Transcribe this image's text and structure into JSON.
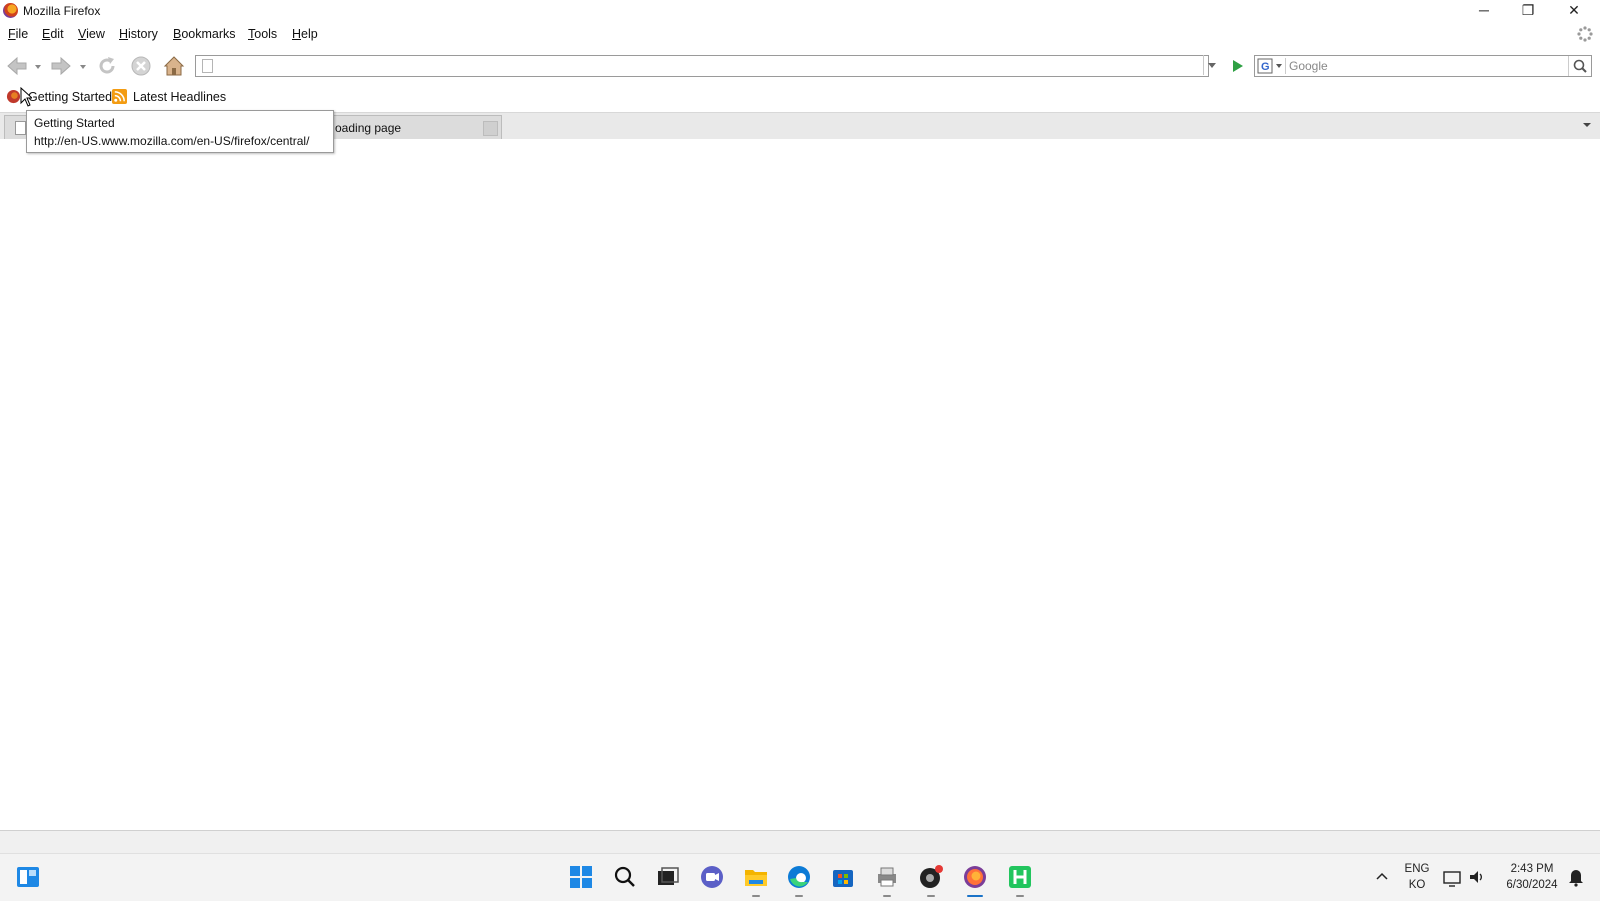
{
  "window": {
    "title": "Mozilla Firefox",
    "controls": {
      "minimize": "─",
      "maximize": "❐",
      "close": "✕"
    }
  },
  "menu": {
    "items": [
      {
        "label": "File",
        "underline": "F",
        "rest": "ile"
      },
      {
        "label": "Edit",
        "underline": "E",
        "rest": "dit"
      },
      {
        "label": "View",
        "underline": "V",
        "rest": "iew"
      },
      {
        "label": "History",
        "underline": "H",
        "rest": "istory"
      },
      {
        "label": "Bookmarks",
        "underline": "B",
        "rest": "ookmarks"
      },
      {
        "label": "Tools",
        "underline": "T",
        "rest": "ools"
      },
      {
        "label": "Help",
        "underline": "H",
        "rest": "elp"
      }
    ]
  },
  "navbar": {
    "url_value": "",
    "search_placeholder": "Google"
  },
  "bookmarks": {
    "items": [
      {
        "label": "Getting Started",
        "icon": "firefox-bookmark-icon"
      },
      {
        "label": "Latest Headlines",
        "icon": "rss-feed-icon"
      }
    ]
  },
  "tabs": {
    "items": [
      {
        "title": "oading page",
        "state": "loading"
      }
    ]
  },
  "tooltip": {
    "title": "Getting Started",
    "url": "http://en-US.www.mozilla.com/en-US/firefox/central/"
  },
  "taskbar": {
    "language_top": "ENG",
    "language_bottom": "KO",
    "time": "2:43 PM",
    "date": "6/30/2024"
  },
  "colors": {
    "accent": "#1a73c8",
    "go_green": "#2ea043",
    "tab_bg": "#dcdcdc"
  }
}
